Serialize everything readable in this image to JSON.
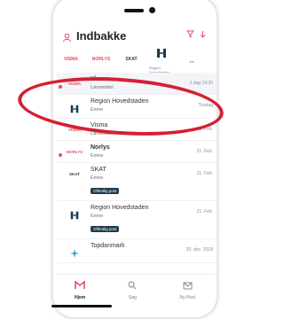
{
  "header": {
    "title": "Indbakke"
  },
  "logos": [
    {
      "name": "VISMA",
      "label": "",
      "color": "#e84a5f"
    },
    {
      "name": "NORLYS",
      "label": "",
      "color": "#e84a5f"
    },
    {
      "name": "SKAT",
      "label": "",
      "color": "#1f3a4a"
    },
    {
      "name": "H",
      "label": "Region Hovedstaden",
      "color": "#1f3a4a"
    },
    {
      "name": "",
      "label": "Afs",
      "color": "#1f3a4a"
    }
  ],
  "messages": [
    {
      "sender": "Visma",
      "subject": "Lønseddel",
      "date": "1 dag 14:30",
      "unread": true,
      "logo": "VISMA",
      "badge": ""
    },
    {
      "sender": "Region Hovedstaden",
      "subject": "Emne",
      "date": "Tirsdag",
      "unread": false,
      "logo": "H",
      "badge": ""
    },
    {
      "sender": "Visma",
      "subject": "Lønseddel",
      "date": "28. Feb.",
      "unread": false,
      "logo": "VISMA",
      "badge": ""
    },
    {
      "sender": "Norlys",
      "subject": "Emne",
      "date": "21. Feb.",
      "unread": true,
      "logo": "NORLYS",
      "badge": ""
    },
    {
      "sender": "SKAT",
      "subject": "Emne",
      "date": "21. Feb.",
      "unread": false,
      "logo": "SKAT",
      "badge": "Offentlig post"
    },
    {
      "sender": "Region Hovedstaden",
      "subject": "Emne",
      "date": "21. Feb.",
      "unread": false,
      "logo": "H",
      "badge": "Offentlig post"
    },
    {
      "sender": "Topdanmark",
      "subject": "",
      "date": "20. dec. 2018",
      "unread": false,
      "logo": "TOP",
      "badge": ""
    }
  ],
  "tabs": [
    {
      "label": "Hjem",
      "icon": "mail-icon",
      "active": true
    },
    {
      "label": "Søg",
      "icon": "search-icon",
      "active": false
    },
    {
      "label": "Ny Post",
      "icon": "compose-icon",
      "active": false
    }
  ],
  "colors": {
    "accent": "#e84a5f",
    "badge": "#1f3a4a",
    "annotation": "#d61f33"
  }
}
